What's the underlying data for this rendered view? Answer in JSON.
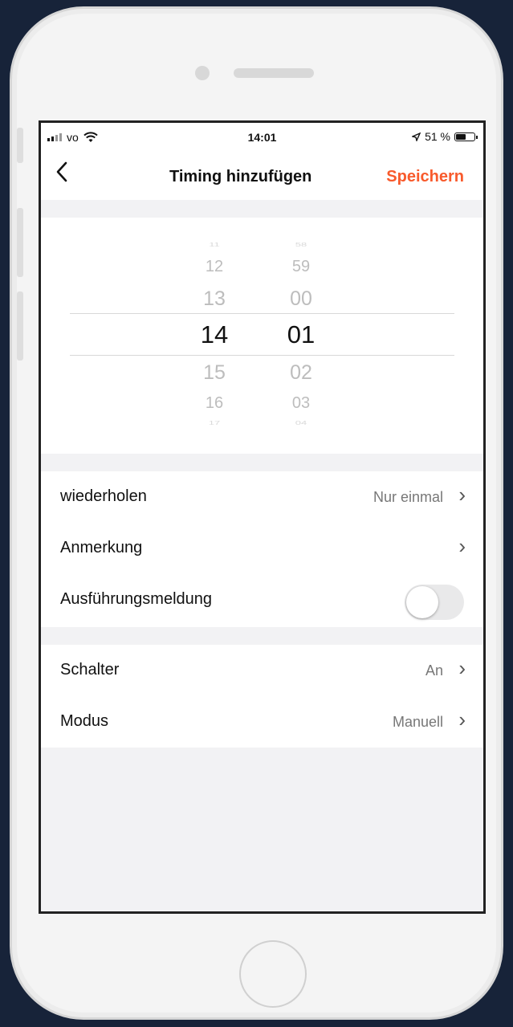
{
  "status": {
    "carrier": "vo",
    "time": "14:01",
    "battery": "51 %"
  },
  "nav": {
    "title": "Timing hinzufügen",
    "save": "Speichern"
  },
  "picker": {
    "hours": [
      "11",
      "12",
      "13",
      "14",
      "15",
      "16",
      "17"
    ],
    "minutes": [
      "58",
      "59",
      "00",
      "01",
      "02",
      "03",
      "04"
    ],
    "selected_hour": "14",
    "selected_minute": "01"
  },
  "settings": {
    "repeat": {
      "label": "wiederholen",
      "value": "Nur einmal"
    },
    "note": {
      "label": "Anmerkung"
    },
    "notification": {
      "label": "Ausführungsmeldung",
      "on": false
    }
  },
  "action": {
    "switch": {
      "label": "Schalter",
      "value": "An"
    },
    "mode": {
      "label": "Modus",
      "value": "Manuell"
    }
  },
  "colors": {
    "accent": "#f85a2c",
    "background": "#172339"
  },
  "icons": {
    "back": "chevron-left-icon",
    "row_arrow": "chevron-right-icon",
    "wifi": "wifi-icon",
    "location": "location-arrow-icon",
    "battery": "battery-icon"
  }
}
